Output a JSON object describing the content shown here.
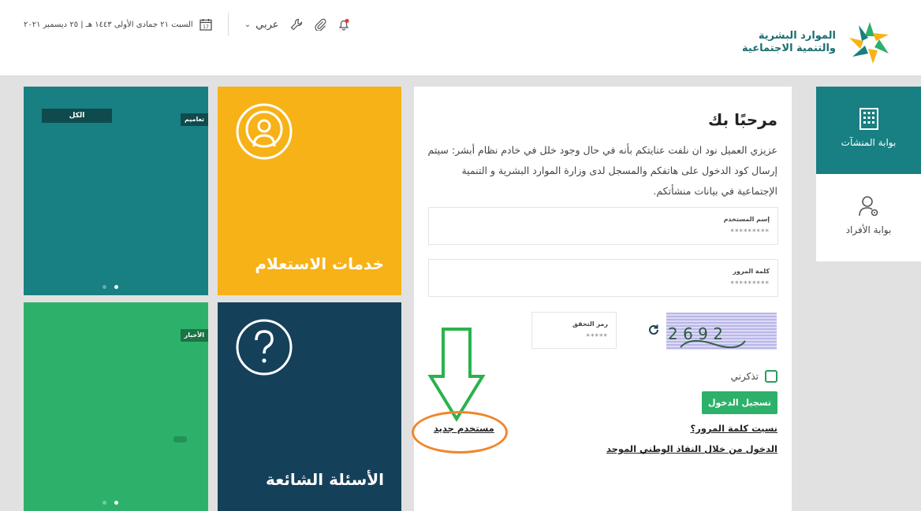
{
  "header": {
    "logo_line1": "الموارد البشرية",
    "logo_line2": "والتنمية الاجتماعية",
    "date": "السبت ٢١ جمادى الأولى ١٤٤٣ هـ | ٢٥ ديسمبر ٢٠٢١",
    "language": "عربي",
    "calendar_day": "17"
  },
  "tiles": {
    "teal": {
      "tag_all": "الكل",
      "tag_small": "تعاميم"
    },
    "inquiry": {
      "title": "خدمات الاستعلام"
    },
    "green": {
      "tag_small": "الأخبار"
    },
    "faq": {
      "title": "الأسئلة الشائعة"
    }
  },
  "login": {
    "welcome": "مرحبًا بك",
    "intro": "عزيزي العميل نود ان نلفت عنايتكم بأنه في حال وجود خلل في خادم نظام أبشر: سيتم إرسال كود الدخول على هاتفكم والمسجل لدى وزارة الموارد البشرية و التنمية الإجتماعية في بيانات منشأتكم.",
    "username_label": "إسم المستخدم",
    "username_value": "*********",
    "password_label": "كلمة المرور",
    "password_value": "*********",
    "code_label": "رمز التحقق",
    "code_value": "*****",
    "captcha_text": "2 6 9 2",
    "remember_label": "تذكرني",
    "login_button": "تسجيل الدخول",
    "forgot_link": "نسيت كلمة المرور؟",
    "nafath_link": "الدخول من خلال النفاذ الوطني الموحد",
    "new_user_link": "مستخدم جديد"
  },
  "portals": {
    "establishments": "بوابة المنشآت",
    "individuals": "بوابة الأفراد"
  },
  "colors": {
    "teal": "#187f82",
    "yellow": "#f7b217",
    "green": "#2db16a",
    "navy": "#15405a",
    "annotation_orange": "#f0862e",
    "annotation_green": "#2bb24c"
  }
}
